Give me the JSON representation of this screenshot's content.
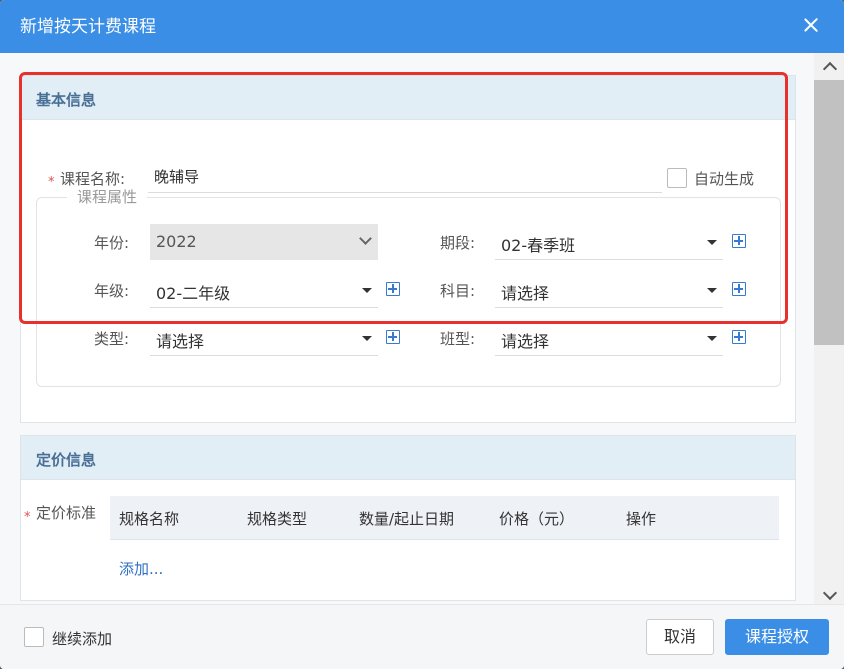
{
  "dialog": {
    "title": "新增按天计费课程"
  },
  "basic": {
    "header": "基本信息",
    "required_mark": "*",
    "course_name_label": "课程名称:",
    "course_name_value": "晚辅导",
    "auto_generate_label": "自动生成",
    "attributes_legend": "课程属性",
    "fields": {
      "year": {
        "label": "年份:",
        "value": "2022",
        "disabled": true
      },
      "period": {
        "label": "期段:",
        "value": "02-春季班"
      },
      "grade": {
        "label": "年级:",
        "value": "02-二年级"
      },
      "subject": {
        "label": "科目:",
        "value": "请选择"
      },
      "type": {
        "label": "类型:",
        "value": "请选择"
      },
      "class_type": {
        "label": "班型:",
        "value": "请选择"
      }
    }
  },
  "pricing": {
    "header": "定价信息",
    "required_mark": "*",
    "standard_label": "定价标准",
    "columns": [
      "规格名称",
      "规格类型",
      "数量/起止日期",
      "价格（元）",
      "操作"
    ],
    "add_link": "添加..."
  },
  "footer": {
    "continue_add_label": "继续添加",
    "cancel_label": "取消",
    "authorize_label": "课程授权"
  },
  "colors": {
    "primary": "#3a8ee6",
    "highlight": "#e8302d",
    "panel_header_bg": "#e1eef5",
    "link": "#2f6fc4"
  }
}
